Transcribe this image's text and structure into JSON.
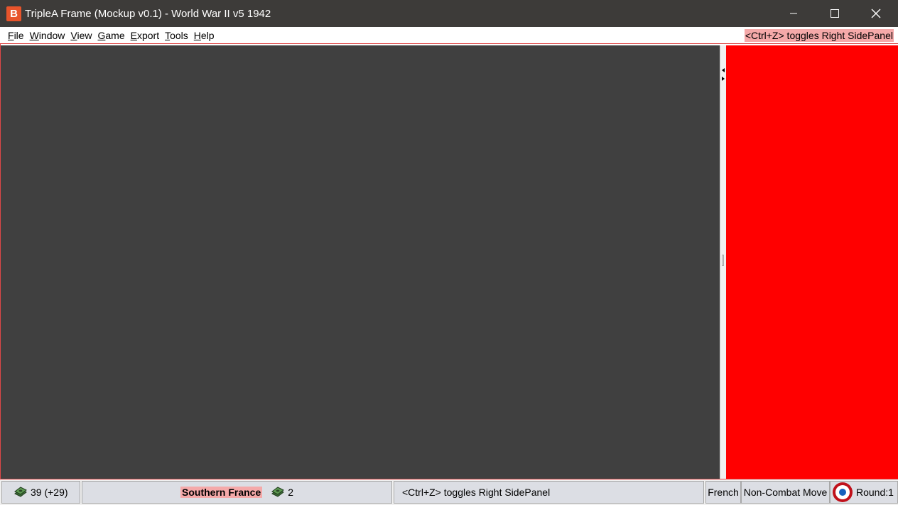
{
  "window": {
    "title": "TripleA Frame (Mockup v0.1) - World War II v5 1942",
    "app_icon_letter": "B"
  },
  "menu": {
    "items": [
      {
        "mnemonic": "F",
        "rest": "ile"
      },
      {
        "mnemonic": "W",
        "rest": "indow"
      },
      {
        "mnemonic": "V",
        "rest": "iew"
      },
      {
        "mnemonic": "G",
        "rest": "ame"
      },
      {
        "mnemonic": "E",
        "rest": "xport"
      },
      {
        "mnemonic": "T",
        "rest": "ools"
      },
      {
        "mnemonic": "H",
        "rest": "elp"
      }
    ],
    "hint": "<Ctrl+Z> toggles Right SidePanel"
  },
  "colors": {
    "titlebar": "#3d3b39",
    "map_background": "#404040",
    "right_panel": "#ff0000",
    "highlight": "#f5a9a9",
    "roundel_outer": "#c0101a",
    "roundel_inner": "#1560bd"
  },
  "status": {
    "money": "39 (+29)",
    "territory_name": "Southern France",
    "territory_value": "2",
    "hint": "<Ctrl+Z> toggles Right SidePanel",
    "player": "French",
    "phase": "Non-Combat Move",
    "round": "Round:1"
  },
  "icons": {
    "money": "money-stack-icon",
    "roundel": "french-roundel-icon"
  }
}
